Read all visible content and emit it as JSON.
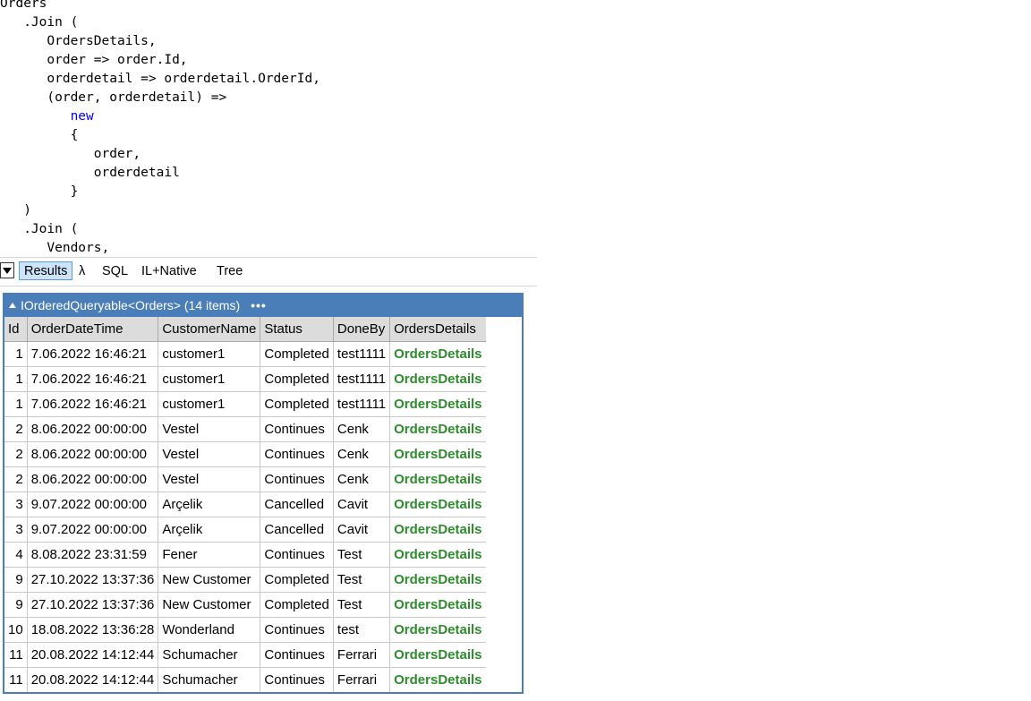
{
  "editor": {
    "lines": [
      {
        "indent": "",
        "text": "Orders",
        "kw": false
      },
      {
        "indent": "   ",
        "text": ".Join (",
        "kw": false
      },
      {
        "indent": "      ",
        "text": "OrdersDetails,",
        "kw": false
      },
      {
        "indent": "      ",
        "text": "order => order.Id,",
        "kw": false
      },
      {
        "indent": "      ",
        "text": "orderdetail => orderdetail.OrderId,",
        "kw": false
      },
      {
        "indent": "      ",
        "text": "(order, orderdetail) =>",
        "kw": false
      },
      {
        "indent": "         ",
        "text": "new",
        "kw": true
      },
      {
        "indent": "         ",
        "text": "{",
        "kw": false
      },
      {
        "indent": "            ",
        "text": "order,",
        "kw": false
      },
      {
        "indent": "            ",
        "text": "orderdetail",
        "kw": false
      },
      {
        "indent": "         ",
        "text": "}",
        "kw": false
      },
      {
        "indent": "   ",
        "text": ")",
        "kw": false
      },
      {
        "indent": "   ",
        "text": ".Join (",
        "kw": false
      },
      {
        "indent": "      ",
        "text": "Vendors,",
        "kw": false
      }
    ]
  },
  "toolbar": {
    "results_label": "Results",
    "lambda_label": "λ",
    "sql_label": "SQL",
    "il_label": "IL+Native",
    "tree_label": "Tree"
  },
  "results": {
    "title": "IOrderedQueryable<Orders> (14 items)",
    "more": "•••",
    "accent_color": "#4a7eb8",
    "link_color": "#2e8b2e",
    "columns": [
      "Id",
      "OrderDateTime",
      "CustomerName",
      "Status",
      "DoneBy",
      "OrdersDetails"
    ],
    "rows": [
      [
        "1",
        "7.06.2022 16:46:21",
        "customer1",
        "Completed",
        "test1111",
        "OrdersDetails"
      ],
      [
        "1",
        "7.06.2022 16:46:21",
        "customer1",
        "Completed",
        "test1111",
        "OrdersDetails"
      ],
      [
        "1",
        "7.06.2022 16:46:21",
        "customer1",
        "Completed",
        "test1111",
        "OrdersDetails"
      ],
      [
        "2",
        "8.06.2022 00:00:00",
        "Vestel",
        "Continues",
        "Cenk",
        "OrdersDetails"
      ],
      [
        "2",
        "8.06.2022 00:00:00",
        "Vestel",
        "Continues",
        "Cenk",
        "OrdersDetails"
      ],
      [
        "2",
        "8.06.2022 00:00:00",
        "Vestel",
        "Continues",
        "Cenk",
        "OrdersDetails"
      ],
      [
        "3",
        "9.07.2022 00:00:00",
        "Arçelik",
        "Cancelled",
        "Cavit",
        "OrdersDetails"
      ],
      [
        "3",
        "9.07.2022 00:00:00",
        "Arçelik",
        "Cancelled",
        "Cavit",
        "OrdersDetails"
      ],
      [
        "4",
        "8.08.2022 23:31:59",
        "Fener",
        "Continues",
        "Test",
        "OrdersDetails"
      ],
      [
        "9",
        "27.10.2022 13:37:36",
        "New Customer",
        "Completed",
        "Test",
        "OrdersDetails"
      ],
      [
        "9",
        "27.10.2022 13:37:36",
        "New Customer",
        "Completed",
        "Test",
        "OrdersDetails"
      ],
      [
        "10",
        "18.08.2022 13:36:28",
        "Wonderland",
        "Continues",
        "test",
        "OrdersDetails"
      ],
      [
        "11",
        "20.08.2022 14:12:44",
        "Schumacher",
        "Continues",
        "Ferrari",
        "OrdersDetails"
      ],
      [
        "11",
        "20.08.2022 14:12:44",
        "Schumacher",
        "Continues",
        "Ferrari",
        "OrdersDetails"
      ]
    ]
  }
}
